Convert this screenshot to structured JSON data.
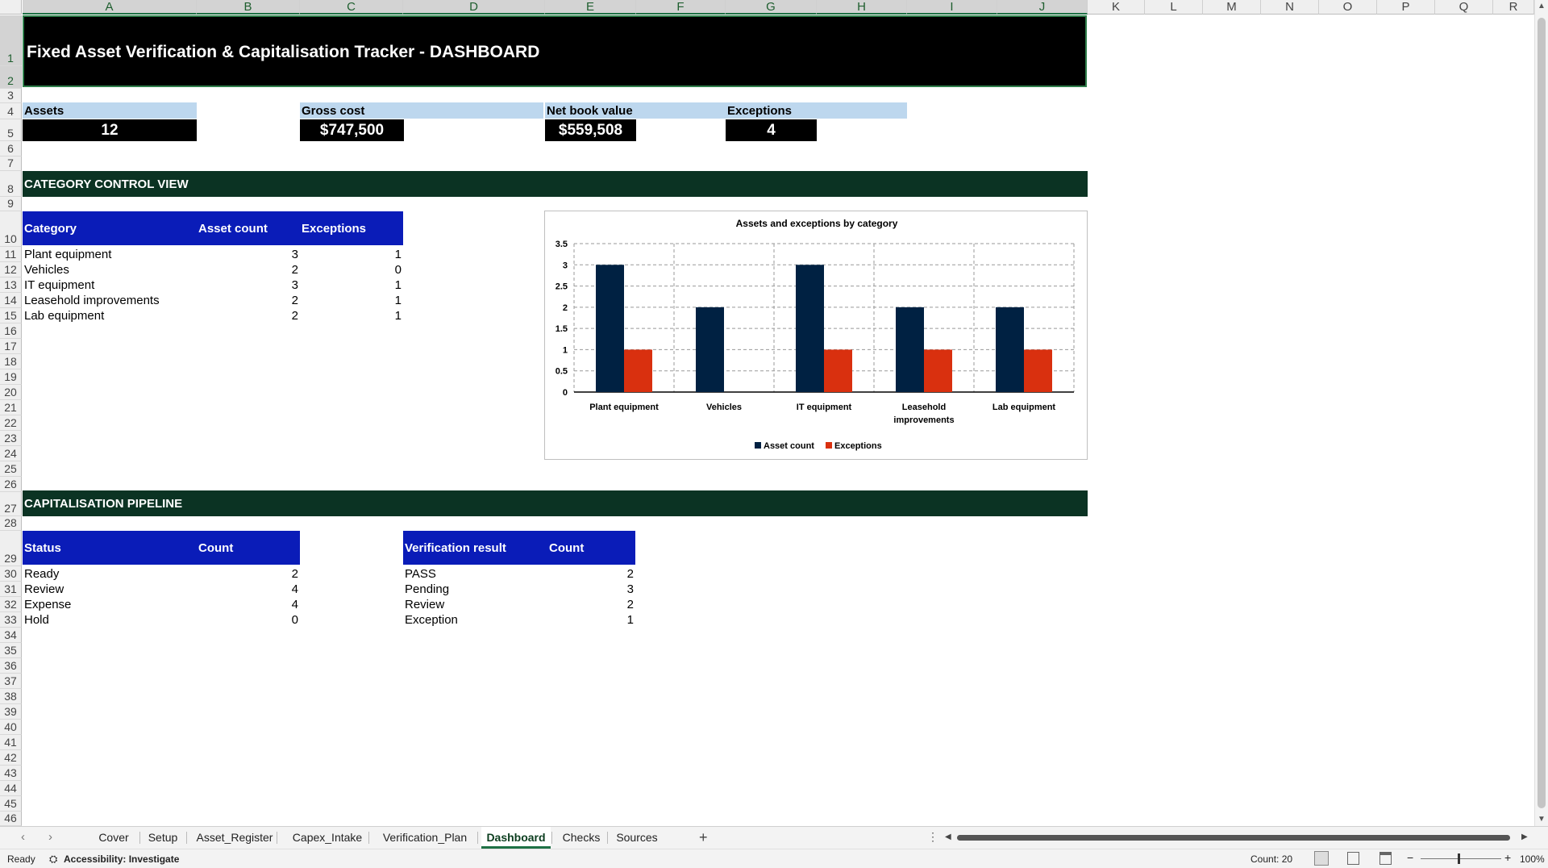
{
  "columns": [
    "A",
    "B",
    "C",
    "D",
    "E",
    "F",
    "G",
    "H",
    "I",
    "J",
    "K",
    "L",
    "M",
    "N",
    "O",
    "P",
    "Q",
    "R"
  ],
  "rows": [
    "1",
    "2",
    "3",
    "4",
    "5",
    "6",
    "7",
    "8",
    "9",
    "10",
    "11",
    "12",
    "13",
    "14",
    "15",
    "16",
    "17",
    "18",
    "19",
    "20",
    "21",
    "22",
    "23",
    "24",
    "25",
    "26",
    "27",
    "28",
    "29",
    "30",
    "31",
    "32",
    "33",
    "34",
    "35",
    "36",
    "37",
    "38",
    "39",
    "40",
    "41",
    "42",
    "43",
    "44",
    "45",
    "46"
  ],
  "banner": {
    "title": "Fixed Asset Verification & Capitalisation Tracker - DASHBOARD"
  },
  "kpis": [
    {
      "label": "Assets",
      "value": "12"
    },
    {
      "label": "Gross cost",
      "value": "$747,500"
    },
    {
      "label": "Net book value",
      "value": "$559,508"
    },
    {
      "label": "Exceptions",
      "value": "4"
    }
  ],
  "sections": {
    "category": "CATEGORY CONTROL VIEW",
    "pipeline": "CAPITALISATION PIPELINE"
  },
  "category_table": {
    "headers": [
      "Category",
      "Asset count",
      "Exceptions"
    ],
    "rows": [
      [
        "Plant equipment",
        "3",
        "1"
      ],
      [
        "Vehicles",
        "2",
        "0"
      ],
      [
        "IT equipment",
        "3",
        "1"
      ],
      [
        "Leasehold improvements",
        "2",
        "1"
      ],
      [
        "Lab equipment",
        "2",
        "1"
      ]
    ]
  },
  "status_table": {
    "headers": [
      "Status",
      "Count"
    ],
    "rows": [
      [
        "Ready",
        "2"
      ],
      [
        "Review",
        "4"
      ],
      [
        "Expense",
        "4"
      ],
      [
        "Hold",
        "0"
      ]
    ]
  },
  "verification_table": {
    "headers": [
      "Verification result",
      "Count"
    ],
    "rows": [
      [
        "PASS",
        "2"
      ],
      [
        "Pending",
        "3"
      ],
      [
        "Review",
        "2"
      ],
      [
        "Exception",
        "1"
      ]
    ]
  },
  "chart_data": {
    "type": "bar",
    "title": "Assets and exceptions by category",
    "categories": [
      "Plant equipment",
      "Vehicles",
      "IT equipment",
      "Leasehold improvements",
      "Lab equipment"
    ],
    "series": [
      {
        "name": "Asset count",
        "values": [
          3,
          2,
          3,
          2,
          2
        ],
        "color": "#002142"
      },
      {
        "name": "Exceptions",
        "values": [
          1,
          0,
          1,
          1,
          1
        ],
        "color": "#d9300f"
      }
    ],
    "ylim": [
      0,
      3.5
    ],
    "yticks": [
      "0",
      "0.5",
      "1",
      "1.5",
      "2",
      "2.5",
      "3",
      "3.5"
    ],
    "grid": true,
    "legend": "bottom"
  },
  "tabs": [
    "Cover",
    "Setup",
    "Asset_Register",
    "Capex_Intake",
    "Verification_Plan",
    "Dashboard",
    "Checks",
    "Sources"
  ],
  "active_tab": "Dashboard",
  "add_sheet": "+",
  "status": {
    "ready": "Ready",
    "accessibility": "Accessibility: Investigate",
    "count": "Count: 20",
    "zoom": "100%"
  },
  "colors": {
    "banner": "#000000",
    "section": "#0b3323",
    "table_header": "#0a1cb8",
    "kpi_label": "#bdd7ee",
    "accent": "#1e7145"
  }
}
